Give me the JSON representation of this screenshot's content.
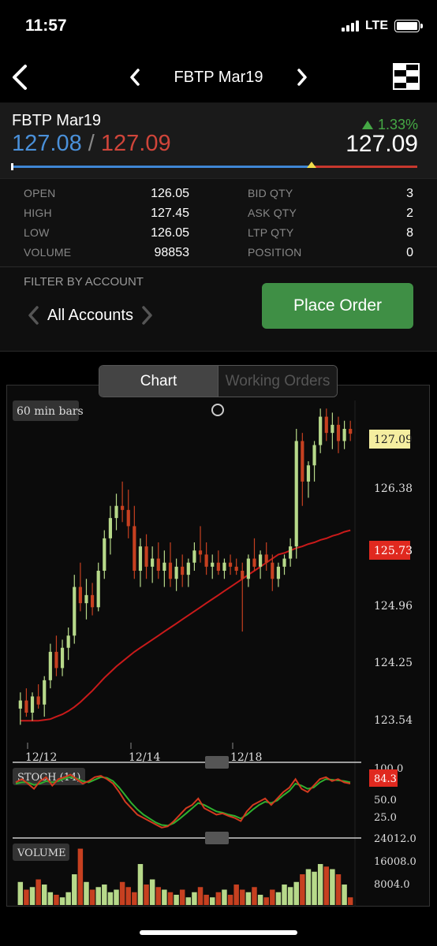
{
  "status_bar": {
    "time": "11:57",
    "network": "LTE"
  },
  "nav": {
    "title": "FBTP Mar19"
  },
  "quote": {
    "name": "FBTP Mar19",
    "bid": "127.08",
    "separator": "/",
    "ask": "127.09",
    "change": "1.33%",
    "last": "127.09",
    "range_position": 0.74,
    "colors": {
      "bid": "#4a90d9",
      "ask": "#d0453a",
      "up": "#45a845"
    }
  },
  "stats": {
    "left": [
      {
        "label": "OPEN",
        "value": "126.05"
      },
      {
        "label": "HIGH",
        "value": "127.45"
      },
      {
        "label": "LOW",
        "value": "126.05"
      },
      {
        "label": "VOLUME",
        "value": "98853"
      }
    ],
    "right": [
      {
        "label": "BID QTY",
        "value": "3"
      },
      {
        "label": "ASK QTY",
        "value": "2"
      },
      {
        "label": "LTP QTY",
        "value": "8"
      },
      {
        "label": "POSITION",
        "value": "0"
      }
    ]
  },
  "account": {
    "filter_label": "FILTER BY ACCOUNT",
    "selected": "All Accounts",
    "place_order_label": "Place Order"
  },
  "tabs": [
    {
      "label": "Chart",
      "active": true
    },
    {
      "label": "Working Orders",
      "active": false
    }
  ],
  "chart_data": {
    "type": "candlestick",
    "interval_label": "60 min bars",
    "x_ticks": [
      "12/12",
      "12/14",
      "12/18"
    ],
    "price_axis": [
      "126.38",
      "124.96",
      "124.25",
      "123.54"
    ],
    "last_price_tag": "127.09",
    "ma_tag": "125.73",
    "price_range": [
      123.3,
      127.5
    ],
    "candles": [
      [
        123.7,
        123.9,
        123.5,
        123.8
      ],
      [
        123.8,
        123.95,
        123.6,
        123.65
      ],
      [
        123.65,
        123.9,
        123.55,
        123.85
      ],
      [
        123.85,
        124.0,
        123.7,
        123.75
      ],
      [
        123.75,
        124.1,
        123.6,
        124.05
      ],
      [
        124.05,
        124.5,
        123.95,
        124.4
      ],
      [
        124.4,
        124.6,
        124.1,
        124.2
      ],
      [
        124.2,
        124.55,
        124.1,
        124.45
      ],
      [
        124.45,
        124.7,
        124.3,
        124.6
      ],
      [
        124.6,
        125.35,
        124.5,
        125.2
      ],
      [
        125.2,
        125.5,
        124.9,
        125.0
      ],
      [
        125.0,
        125.3,
        124.8,
        125.1
      ],
      [
        125.1,
        125.25,
        124.85,
        124.95
      ],
      [
        124.95,
        125.5,
        124.9,
        125.4
      ],
      [
        125.4,
        125.9,
        125.3,
        125.8
      ],
      [
        125.8,
        126.2,
        125.6,
        126.05
      ],
      [
        126.05,
        126.35,
        125.9,
        126.2
      ],
      [
        126.2,
        126.5,
        126.0,
        126.15
      ],
      [
        126.15,
        126.4,
        125.8,
        125.95
      ],
      [
        125.95,
        126.2,
        125.3,
        125.4
      ],
      [
        125.4,
        125.8,
        125.2,
        125.7
      ],
      [
        125.7,
        125.85,
        125.3,
        125.45
      ],
      [
        125.45,
        125.7,
        125.25,
        125.55
      ],
      [
        125.55,
        125.75,
        125.3,
        125.4
      ],
      [
        125.4,
        125.65,
        125.2,
        125.5
      ],
      [
        125.5,
        125.75,
        125.2,
        125.3
      ],
      [
        125.3,
        125.55,
        125.15,
        125.45
      ],
      [
        125.45,
        125.6,
        125.2,
        125.35
      ],
      [
        125.35,
        125.55,
        125.2,
        125.5
      ],
      [
        125.5,
        125.75,
        125.4,
        125.65
      ],
      [
        125.65,
        125.95,
        125.5,
        125.6
      ],
      [
        125.6,
        125.75,
        125.35,
        125.45
      ],
      [
        125.45,
        125.6,
        125.3,
        125.5
      ],
      [
        125.5,
        125.65,
        125.35,
        125.4
      ],
      [
        125.4,
        125.55,
        125.3,
        125.5
      ],
      [
        125.5,
        125.6,
        125.35,
        125.45
      ],
      [
        125.45,
        125.55,
        125.35,
        125.4
      ],
      [
        125.4,
        125.5,
        124.65,
        125.3
      ],
      [
        125.3,
        125.6,
        125.2,
        125.55
      ],
      [
        125.55,
        125.8,
        125.4,
        125.45
      ],
      [
        125.45,
        125.65,
        125.3,
        125.6
      ],
      [
        125.6,
        125.75,
        125.4,
        125.5
      ],
      [
        125.5,
        125.6,
        125.15,
        125.3
      ],
      [
        125.3,
        125.5,
        125.2,
        125.45
      ],
      [
        125.45,
        125.6,
        125.35,
        125.55
      ],
      [
        125.55,
        125.8,
        125.45,
        125.7
      ],
      [
        125.7,
        127.15,
        125.55,
        127.0
      ],
      [
        127.0,
        127.1,
        126.2,
        126.5
      ],
      [
        126.5,
        126.75,
        126.3,
        126.7
      ],
      [
        126.7,
        127.0,
        126.5,
        126.95
      ],
      [
        126.95,
        127.4,
        126.85,
        127.3
      ],
      [
        127.3,
        127.4,
        127.0,
        127.1
      ],
      [
        127.1,
        127.35,
        126.9,
        127.2
      ],
      [
        127.2,
        127.3,
        126.85,
        127.0
      ],
      [
        127.0,
        127.25,
        126.9,
        127.15
      ],
      [
        127.15,
        127.25,
        127.0,
        127.09
      ]
    ],
    "moving_average": [
      123.55,
      123.55,
      123.55,
      123.55,
      123.56,
      123.57,
      123.6,
      123.63,
      123.67,
      123.72,
      123.78,
      123.85,
      123.92,
      124.0,
      124.08,
      124.15,
      124.22,
      124.28,
      124.34,
      124.4,
      124.45,
      124.5,
      124.55,
      124.6,
      124.65,
      124.7,
      124.75,
      124.8,
      124.85,
      124.9,
      124.95,
      125.0,
      125.05,
      125.1,
      125.15,
      125.2,
      125.25,
      125.3,
      125.35,
      125.4,
      125.45,
      125.5,
      125.55,
      125.6,
      125.62,
      125.65,
      125.68,
      125.7,
      125.73,
      125.75,
      125.78,
      125.8,
      125.83,
      125.85,
      125.88,
      125.9
    ],
    "stoch": {
      "label": "STOCH (14)",
      "axis": [
        "100.0",
        "50.0",
        "25.0"
      ],
      "value_tag": "84.3",
      "k": [
        80,
        85,
        78,
        70,
        82,
        88,
        75,
        85,
        88,
        92,
        85,
        78,
        82,
        88,
        90,
        85,
        78,
        65,
        50,
        40,
        30,
        25,
        20,
        15,
        10,
        12,
        20,
        30,
        40,
        45,
        55,
        40,
        35,
        30,
        32,
        28,
        25,
        20,
        35,
        45,
        50,
        55,
        45,
        55,
        65,
        72,
        85,
        70,
        65,
        75,
        85,
        88,
        82,
        85,
        80,
        78
      ],
      "d": [
        78,
        80,
        80,
        76,
        78,
        82,
        80,
        82,
        86,
        88,
        86,
        82,
        80,
        84,
        88,
        87,
        82,
        72,
        60,
        48,
        38,
        30,
        24,
        18,
        14,
        13,
        17,
        24,
        32,
        40,
        48,
        45,
        40,
        35,
        33,
        30,
        28,
        24,
        30,
        38,
        45,
        50,
        48,
        52,
        60,
        67,
        78,
        75,
        70,
        72,
        80,
        85,
        84,
        83,
        82,
        80
      ]
    },
    "volume": {
      "label": "VOLUME",
      "axis": [
        "24012.0",
        "16008.0",
        "8004.0"
      ],
      "values": [
        9000,
        6000,
        7000,
        10000,
        8000,
        5000,
        4000,
        3000,
        5000,
        12000,
        22000,
        9000,
        6000,
        7000,
        8000,
        5000,
        6000,
        9000,
        7000,
        5000,
        16000,
        8000,
        10000,
        7000,
        6000,
        5000,
        4000,
        6000,
        3000,
        5000,
        7000,
        4000,
        3000,
        5000,
        6000,
        4000,
        8000,
        6000,
        5000,
        7000,
        4000,
        3000,
        6000,
        5000,
        8000,
        7000,
        9000,
        12000,
        14000,
        13000,
        16000,
        15000,
        14000,
        12000,
        8000,
        3000
      ]
    },
    "colors": {
      "up": "#b7d98a",
      "down": "#c64020",
      "ma": "#c91a1a",
      "stoch_k": "#d23a1f",
      "stoch_d": "#2fb02f",
      "last_tag": "#f5eea0",
      "ma_tag": "#e0291f"
    }
  }
}
